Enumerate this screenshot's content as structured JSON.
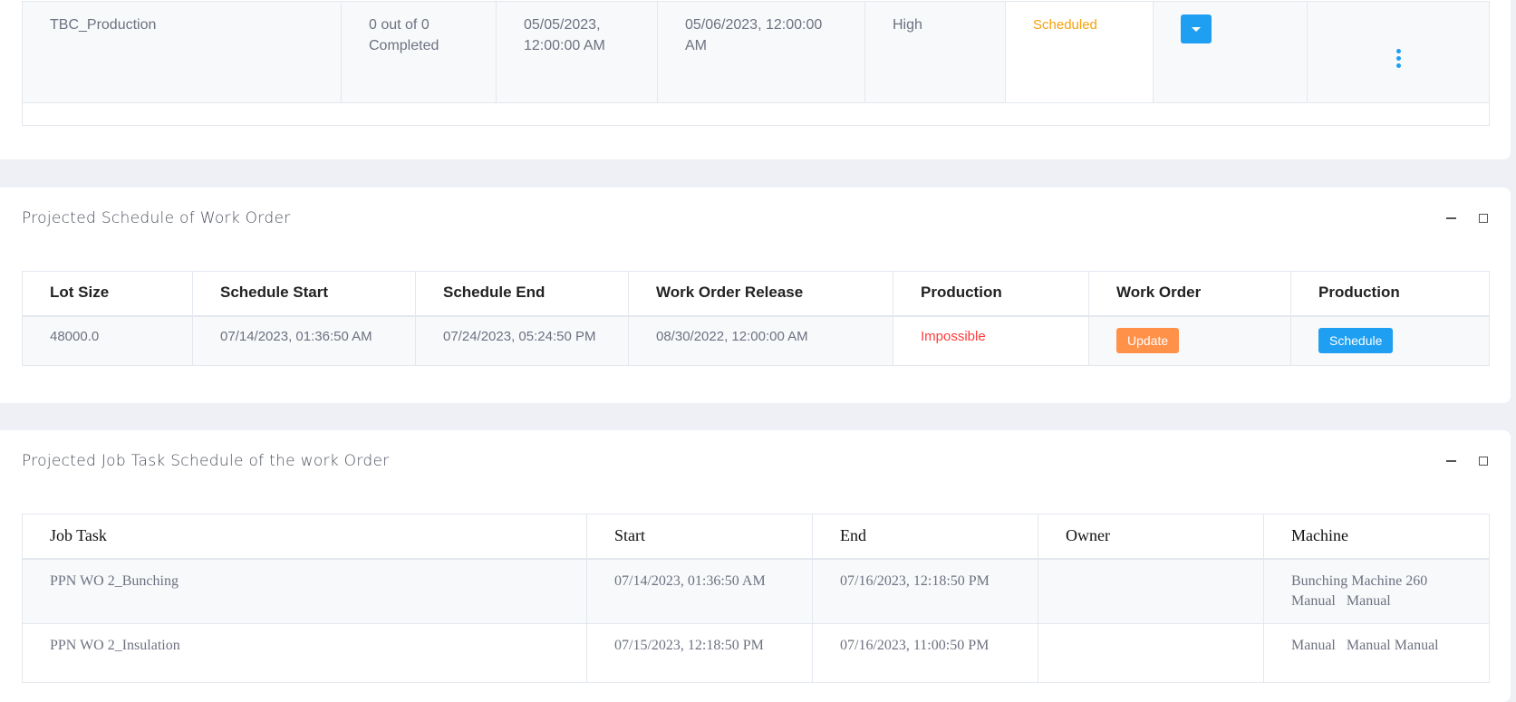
{
  "work_order_row": {
    "name": "TBC_Production",
    "progress": "0 out of 0 Completed",
    "start": "05/05/2023, 12:00:00 AM",
    "end": "05/06/2023, 12:00:00 AM",
    "priority": "High",
    "status": "Scheduled",
    "status_color": "#f6a10b",
    "dropdown_icon": "caret-down-icon",
    "more_icon": "vertical-ellipsis-icon"
  },
  "projected_schedule": {
    "title": "Projected Schedule of Work Order",
    "tools": [
      "minimize-icon",
      "expand-icon"
    ],
    "columns": [
      "Lot Size",
      "Schedule Start",
      "Schedule End",
      "Work Order Release",
      "Production",
      "Work Order",
      "Production"
    ],
    "row": {
      "lot_size": "48000.0",
      "schedule_start": "07/14/2023, 01:36:50 AM",
      "schedule_end": "07/24/2023, 05:24:50 PM",
      "work_order_release": "08/30/2022, 12:00:00 AM",
      "production": "Impossible",
      "update_label": "Update",
      "schedule_label": "Schedule"
    }
  },
  "job_task_schedule": {
    "title": "Projected Job Task Schedule of the work Order",
    "tools": [
      "minimize-icon",
      "expand-icon"
    ],
    "columns": [
      "Job Task",
      "Start",
      "End",
      "Owner",
      "Machine"
    ],
    "rows": [
      {
        "job_task": "PPN WO 2_Bunching",
        "start": "07/14/2023, 01:36:50 AM",
        "end": "07/16/2023, 12:18:50 PM",
        "owner": "",
        "machine": "Bunching Machine 260 Manual   Manual"
      },
      {
        "job_task": "PPN WO 2_Insulation",
        "start": "07/15/2023, 12:18:50 PM",
        "end": "07/16/2023, 11:00:50 PM",
        "owner": "",
        "machine": "Manual   Manual Manual"
      }
    ]
  }
}
